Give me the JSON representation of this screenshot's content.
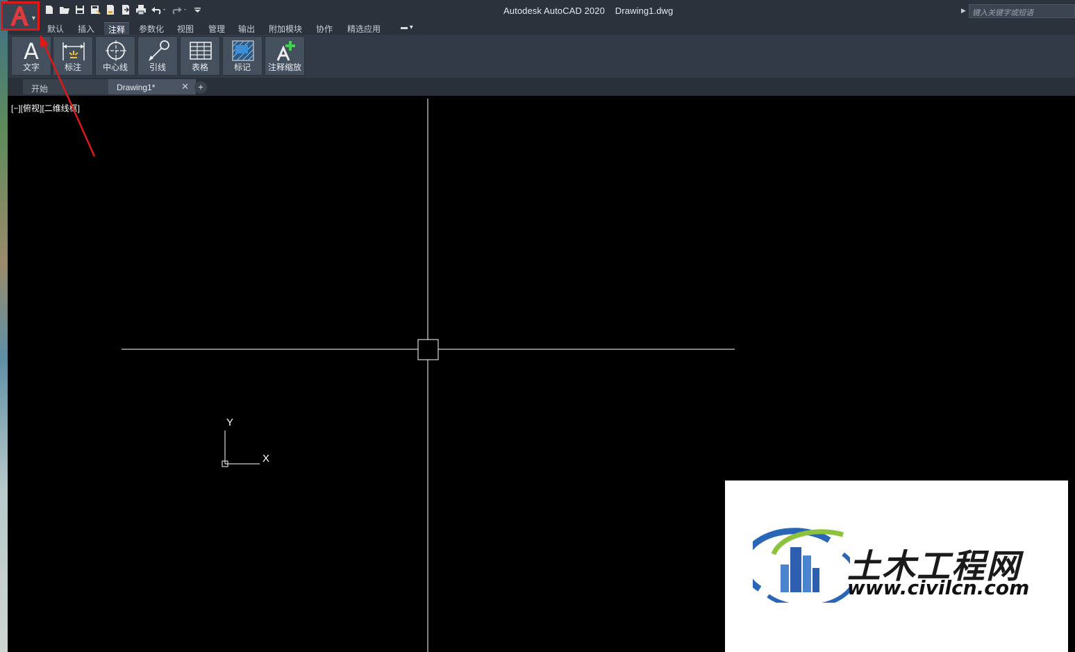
{
  "titlebar": {
    "app_name": "Autodesk AutoCAD 2020",
    "file_name": "Drawing1.dwg",
    "search_placeholder": "键入关键字或短语"
  },
  "quick_access": {
    "icons": [
      "new-icon",
      "open-icon",
      "save-icon",
      "save-as-icon",
      "plot-preview-icon",
      "export-icon",
      "print-icon",
      "undo-icon",
      "redo-icon",
      "customize-icon"
    ]
  },
  "menu": {
    "tabs": [
      "默认",
      "插入",
      "注释",
      "参数化",
      "视图",
      "管理",
      "输出",
      "附加模块",
      "协作",
      "精选应用"
    ],
    "active": "注释"
  },
  "ribbon": {
    "tools": [
      {
        "label": "文字",
        "icon": "text-icon"
      },
      {
        "label": "标注",
        "icon": "dimension-icon"
      },
      {
        "label": "中心线",
        "icon": "centerline-icon"
      },
      {
        "label": "引线",
        "icon": "leader-icon"
      },
      {
        "label": "表格",
        "icon": "table-icon"
      },
      {
        "label": "标记",
        "icon": "markup-icon"
      },
      {
        "label": "注释缩放",
        "icon": "annotation-scale-icon"
      }
    ]
  },
  "documents": {
    "tabs": [
      {
        "label": "开始",
        "active": false
      },
      {
        "label": "Drawing1*",
        "active": true
      }
    ]
  },
  "viewport": {
    "label": "[−][俯视][二维线框]",
    "ucs_x": "X",
    "ucs_y": "Y"
  },
  "watermark": {
    "title": "土木工程网",
    "url": "www.civilcn.com"
  },
  "colors": {
    "highlight": "#e01818",
    "background": "#000000",
    "ribbon": "#323a45"
  }
}
